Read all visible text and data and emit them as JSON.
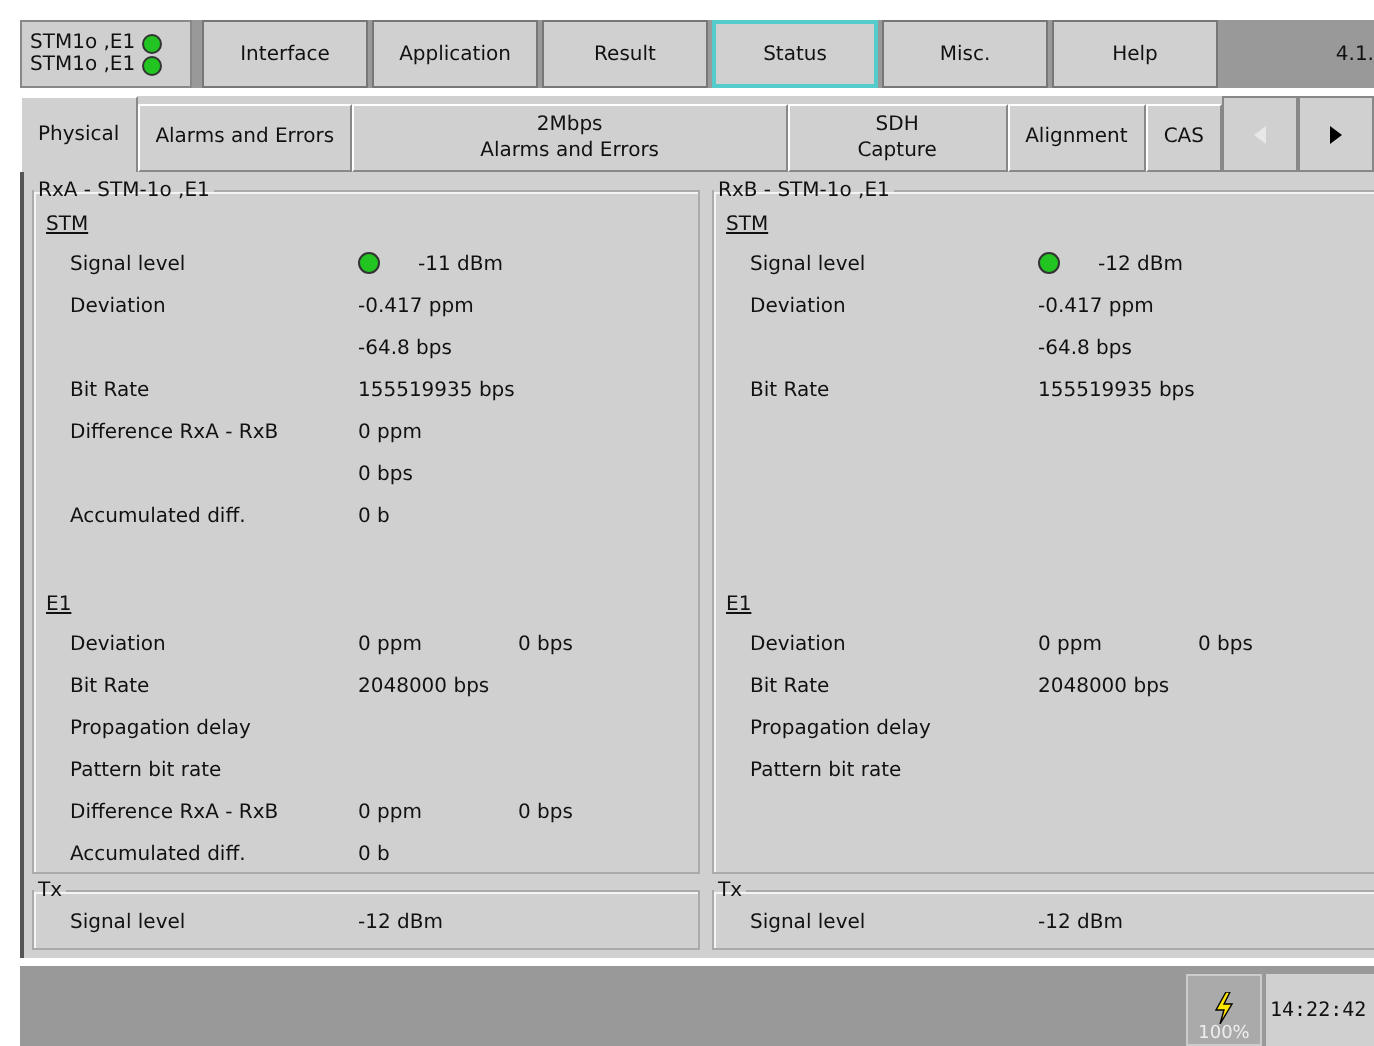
{
  "indicators": [
    {
      "label": "STM1o ,E1",
      "color": "#22c422"
    },
    {
      "label": "STM1o ,E1",
      "color": "#22c422"
    }
  ],
  "menu": [
    {
      "label": "Interface",
      "selected": false
    },
    {
      "label": "Application",
      "selected": false
    },
    {
      "label": "Result",
      "selected": false
    },
    {
      "label": "Status",
      "selected": true
    },
    {
      "label": "Misc.",
      "selected": false
    },
    {
      "label": "Help",
      "selected": false
    }
  ],
  "version": "4.1.",
  "subtabs": [
    {
      "label": "Physical",
      "selected": true
    },
    {
      "label": "Alarms and Errors",
      "selected": false
    },
    {
      "label": "2Mbps\nAlarms and Errors",
      "selected": false
    },
    {
      "label": "SDH\nCapture",
      "selected": false
    },
    {
      "label": "Alignment",
      "selected": false
    },
    {
      "label": "CAS",
      "selected": false
    }
  ],
  "scroll": {
    "left_disabled": true,
    "right_disabled": false
  },
  "panels": [
    {
      "title": "RxA - STM-1o ,E1",
      "sections": [
        {
          "title": "STM",
          "rows": [
            {
              "label": "Signal level",
              "values": [
                "-11 dBm"
              ],
              "color": "#22c422"
            },
            {
              "label": "Deviation",
              "values": [
                "-0.417 ppm"
              ]
            },
            {
              "values": [
                "-64.8 bps"
              ]
            },
            {
              "label": "Bit Rate",
              "values": [
                "155519935 bps"
              ]
            },
            {
              "label": "Difference RxA - RxB",
              "values": [
                "0 ppm"
              ]
            },
            {
              "values": [
                "0 bps"
              ]
            },
            {
              "label": "Accumulated diff.",
              "values": [
                "0 b"
              ]
            }
          ]
        },
        {
          "title": "E1",
          "rows": [
            {
              "label": "Deviation",
              "values": [
                "0 ppm",
                "0 bps"
              ]
            },
            {
              "label": "Bit Rate",
              "values": [
                "2048000 bps"
              ]
            },
            {
              "label": "Propagation delay"
            },
            {
              "label": "Pattern bit rate"
            },
            {
              "label": "Difference RxA - RxB",
              "values": [
                "0 ppm",
                "0 bps"
              ]
            },
            {
              "label": "Accumulated diff.",
              "values": [
                "0 b"
              ]
            }
          ]
        }
      ]
    },
    {
      "title": "RxB - STM-1o ,E1",
      "sections": [
        {
          "title": "STM",
          "rows": [
            {
              "label": "Signal level",
              "values": [
                "-12 dBm"
              ],
              "color": "#22c422"
            },
            {
              "label": "Deviation",
              "values": [
                "-0.417 ppm"
              ]
            },
            {
              "values": [
                "-64.8 bps"
              ]
            },
            {
              "label": "Bit Rate",
              "values": [
                "155519935 bps"
              ]
            }
          ]
        },
        {
          "title": "E1",
          "rows": [
            {
              "label": "Deviation",
              "values": [
                "0 ppm",
                "0 bps"
              ]
            },
            {
              "label": "Bit Rate",
              "values": [
                "2048000 bps"
              ]
            },
            {
              "label": "Propagation delay"
            },
            {
              "label": "Pattern bit rate"
            }
          ]
        }
      ]
    }
  ],
  "tx": [
    {
      "title": "Tx",
      "label": "Signal level",
      "value": "-12 dBm"
    },
    {
      "title": "Tx",
      "label": "Signal level",
      "value": "-12 dBm"
    }
  ],
  "status_bar": {
    "battery": "100%",
    "time": "14:22:42"
  }
}
